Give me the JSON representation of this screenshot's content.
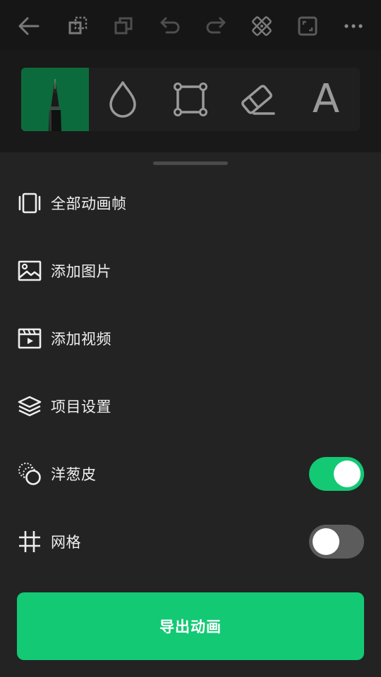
{
  "toolbar": {
    "icons": [
      "back-arrow-icon",
      "duplicate-layer-icon",
      "copy-icon",
      "undo-icon",
      "redo-icon",
      "transform-tool-icon",
      "fullscreen-icon",
      "more-options-icon"
    ]
  },
  "tools": {
    "items": [
      "pen-icon",
      "ink-drop-icon",
      "selection-rect-icon",
      "eraser-icon",
      "text-tool-icon"
    ],
    "active": "pen-icon",
    "text_glyph": "A"
  },
  "menu": {
    "all_frames": "全部动画帧",
    "add_image": "添加图片",
    "add_video": "添加视频",
    "project_settings": "项目设置",
    "onion_skin": "洋葱皮",
    "grid": "网格"
  },
  "toggles": {
    "onion_skin_on": true,
    "grid_on": false
  },
  "export": {
    "label": "导出动画"
  },
  "colors": {
    "accent": "#13c974",
    "active_tool_bg": "#0c6b3c",
    "sheet_bg": "#232323",
    "toolbar_bg": "#161616"
  }
}
